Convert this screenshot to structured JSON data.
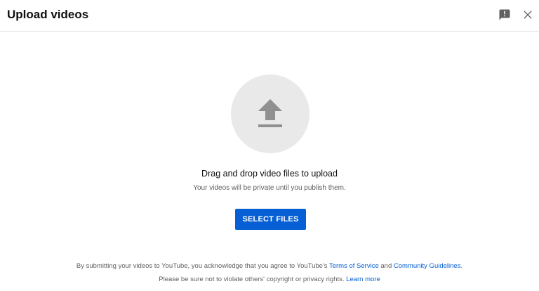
{
  "header": {
    "title": "Upload videos",
    "feedback_icon": "feedback-icon",
    "close_icon": "close-icon"
  },
  "upload": {
    "icon": "upload-arrow-icon",
    "drag_text": "Drag and drop video files to upload",
    "private_text": "Your videos will be private until you publish them.",
    "select_button_label": "SELECT FILES"
  },
  "footer": {
    "line1_prefix": "By submitting your videos to YouTube, you acknowledge that you agree to YouTube's",
    "terms_link": "Terms of Service",
    "and": "and",
    "community_link": "Community Guidelines",
    "line1_suffix": ".",
    "line2_prefix": "Please be sure not to violate others' copyright or privacy rights.",
    "learn_more_link": "Learn more"
  },
  "colors": {
    "accent": "#065fd4",
    "circle_bg": "#e9e9e9",
    "icon_gray": "#909090",
    "secondary_text": "#606060"
  }
}
